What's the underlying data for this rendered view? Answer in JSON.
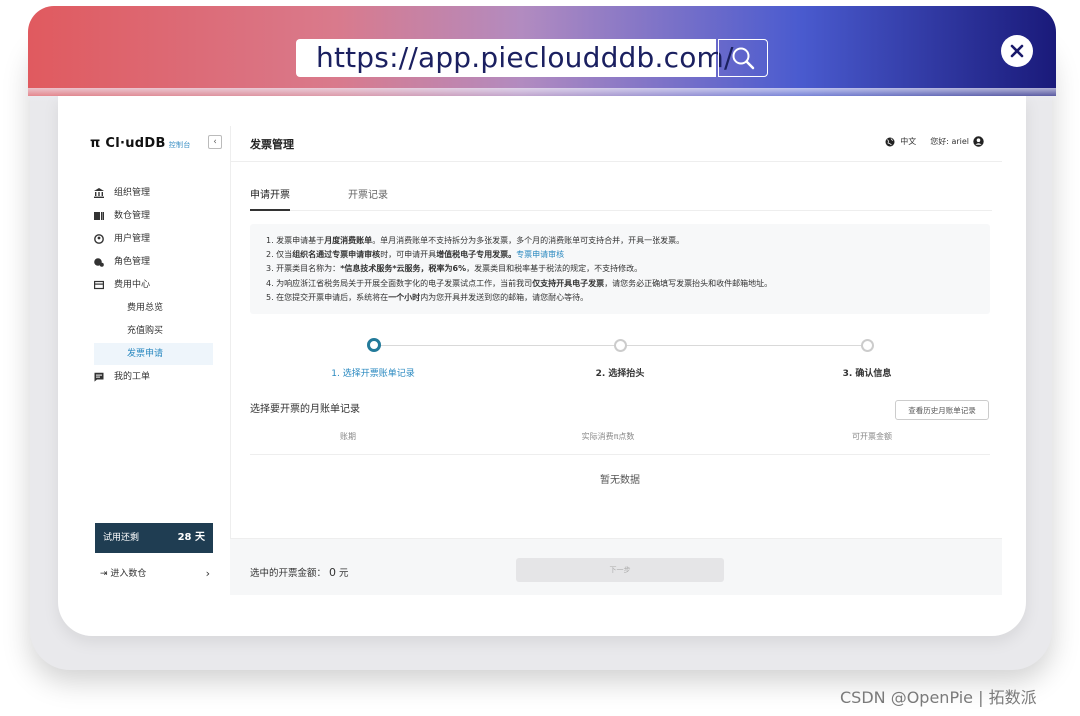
{
  "browser": {
    "url": "https://app.piecloudddb.com/"
  },
  "sidebar": {
    "logo": "π Cl·udDB",
    "logo_sub": "控制台",
    "items": [
      {
        "label": "组织管理",
        "icon": "bank-icon"
      },
      {
        "label": "数仓管理",
        "icon": "database-icon"
      },
      {
        "label": "用户管理",
        "icon": "user-circle-icon"
      },
      {
        "label": "角色管理",
        "icon": "role-icon"
      },
      {
        "label": "费用中心",
        "icon": "card-icon"
      }
    ],
    "sub_items": [
      {
        "label": "费用总览",
        "active": false
      },
      {
        "label": "充值购买",
        "active": false
      },
      {
        "label": "发票申请",
        "active": true
      }
    ],
    "tickets": {
      "label": "我的工单",
      "icon": "ticket-icon"
    },
    "trial": {
      "label": "试用还剩",
      "days": "28 天"
    },
    "enter": {
      "label": "进入数仓",
      "arrow": "›"
    }
  },
  "header": {
    "title": "发票管理",
    "language": "中文",
    "greeting": "您好: ariel"
  },
  "tabs": [
    {
      "label": "申请开票",
      "active": true
    },
    {
      "label": "开票记录",
      "active": false
    }
  ],
  "notice": {
    "line1_a": "1. 发票申请基于",
    "line1_b": "月度消费账单",
    "line1_c": "。单月消费账单不支持拆分为多张发票，多个月的消费账单可支持合并，开具一张发票。",
    "line2_a": "2. 仅当",
    "line2_b": "组织名通过专票申请审核",
    "line2_c": "时，可申请开具",
    "line2_d": "增值税电子专用发票。",
    "line2_link": "专票申请审核",
    "line3_a": "3. 开票类目名称为：",
    "line3_b": "*信息技术服务*云服务，税率为6%",
    "line3_c": "，发票类目和税率基于税法的规定，不支持修改。",
    "line4_a": "4. 为响应浙江省税务局关于开展全面数字化的电子发票试点工作，当前我司",
    "line4_b": "仅支持开具电子发票",
    "line4_c": "，请您务必正确填写发票抬头和收件邮箱地址。",
    "line5_a": "5. 在您提交开票申请后，系统将在",
    "line5_b": "一个小时",
    "line5_c": "内为您开具并发送到您的邮箱，请您耐心等待。"
  },
  "steps": [
    {
      "label": "1. 选择开票账单记录",
      "active": true
    },
    {
      "label": "2. 选择抬头",
      "active": false
    },
    {
      "label": "3. 确认信息",
      "active": false
    }
  ],
  "section": {
    "title": "选择要开票的月账单记录",
    "history_button": "查看历史月账单记录"
  },
  "table": {
    "columns": [
      "账期",
      "实际消费π点数",
      "可开票金额"
    ],
    "empty": "暂无数据"
  },
  "footer": {
    "selected_label": "选中的开票金额：",
    "selected_amount": "0",
    "unit": "元",
    "next_button": "下一步"
  },
  "watermark": "CSDN @OpenPie | 拓数派",
  "colors": {
    "accent": "#2a89c0",
    "step_active": "#237a9a",
    "trial_bg": "#1f3d52"
  }
}
